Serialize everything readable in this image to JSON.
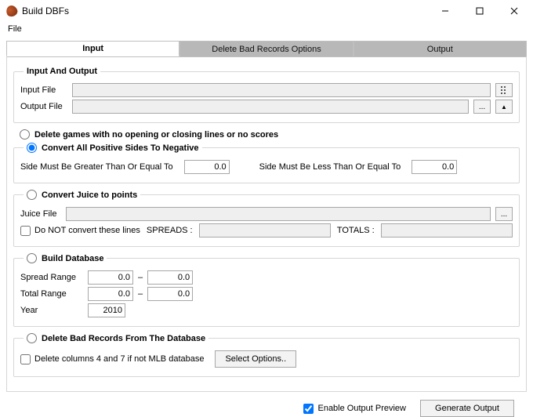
{
  "window": {
    "title": "Build DBFs"
  },
  "menu": {
    "file": "File"
  },
  "tabs": {
    "input": "Input",
    "delete_opts": "Delete Bad Records Options",
    "output": "Output"
  },
  "io_group": {
    "title": "Input And Output",
    "input_label": "Input File",
    "input_value": "",
    "output_label": "Output File",
    "output_value": "",
    "browse_aria": "Browse"
  },
  "delete_games_radio": "Delete games with no opening or closing lines or no scores",
  "convert_neg": {
    "title": "Convert All Positive Sides To Negative",
    "ge_label": "Side Must Be Greater Than Or Equal To",
    "ge_value": "0.0",
    "le_label": "Side Must Be Less Than Or Equal To",
    "le_value": "0.0"
  },
  "juice": {
    "title": "Convert Juice to points",
    "file_label": "Juice File",
    "file_value": "",
    "dont_convert_label": "Do NOT convert these lines",
    "spreads_label": "SPREADS :",
    "spreads_value": "",
    "totals_label": "TOTALS :",
    "totals_value": ""
  },
  "build_db": {
    "title": "Build Database",
    "spread_label": "Spread Range",
    "spread_lo": "0.0",
    "spread_hi": "0.0",
    "total_label": "Total Range",
    "total_lo": "0.0",
    "total_hi": "0.0",
    "year_label": "Year",
    "year_value": "2010",
    "dash": "–"
  },
  "delete_bad": {
    "title": "Delete Bad Records From The Database",
    "chk_label": "Delete columns 4 and 7 if not MLB database",
    "select_btn": "Select Options.."
  },
  "footer": {
    "enable_preview": "Enable Output Preview",
    "generate": "Generate Output"
  },
  "glyphs": {
    "ellipsis": "...",
    "up_arrow": "▲"
  }
}
